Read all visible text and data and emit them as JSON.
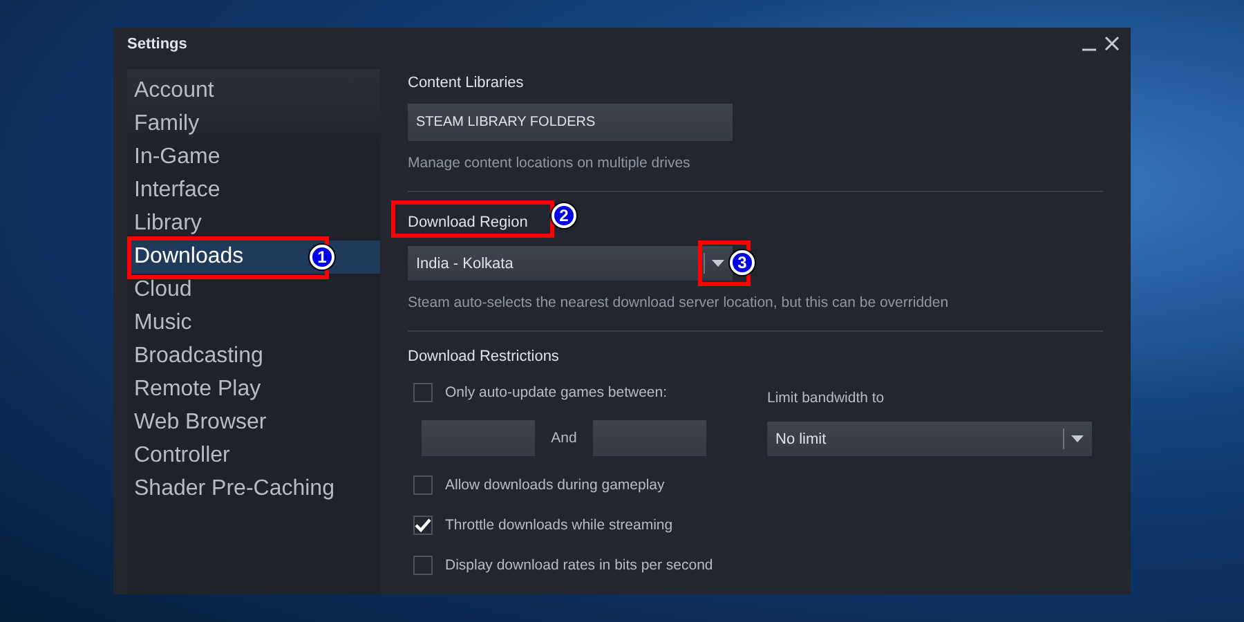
{
  "window": {
    "title": "Settings"
  },
  "sidebar": {
    "items": [
      {
        "label": "Account",
        "selected": false
      },
      {
        "label": "Family",
        "selected": false
      },
      {
        "label": "In-Game",
        "selected": false
      },
      {
        "label": "Interface",
        "selected": false
      },
      {
        "label": "Library",
        "selected": false
      },
      {
        "label": "Downloads",
        "selected": true,
        "annotation": "1"
      },
      {
        "label": "Cloud",
        "selected": false
      },
      {
        "label": "Music",
        "selected": false
      },
      {
        "label": "Broadcasting",
        "selected": false
      },
      {
        "label": "Remote Play",
        "selected": false
      },
      {
        "label": "Web Browser",
        "selected": false
      },
      {
        "label": "Controller",
        "selected": false
      },
      {
        "label": "Shader Pre-Caching",
        "selected": false
      }
    ]
  },
  "content_libraries": {
    "heading": "Content Libraries",
    "button": "STEAM LIBRARY FOLDERS",
    "description": "Manage content locations on multiple drives"
  },
  "download_region": {
    "heading": "Download Region",
    "heading_annotation": "2",
    "dropdown": {
      "value": "India - Kolkata",
      "arrow_annotation": "3"
    },
    "description": "Steam auto-selects the nearest download server location, but this can be overridden"
  },
  "download_restrictions": {
    "heading": "Download Restrictions",
    "auto_update": {
      "label": "Only auto-update games between:",
      "checked": false,
      "between_label": "And"
    },
    "bandwidth": {
      "label": "Limit bandwidth to",
      "value": "No limit"
    },
    "options": [
      {
        "label": "Allow downloads during gameplay",
        "checked": false
      },
      {
        "label": "Throttle downloads while streaming",
        "checked": true
      },
      {
        "label": "Display download rates in bits per second",
        "checked": false
      }
    ]
  }
}
